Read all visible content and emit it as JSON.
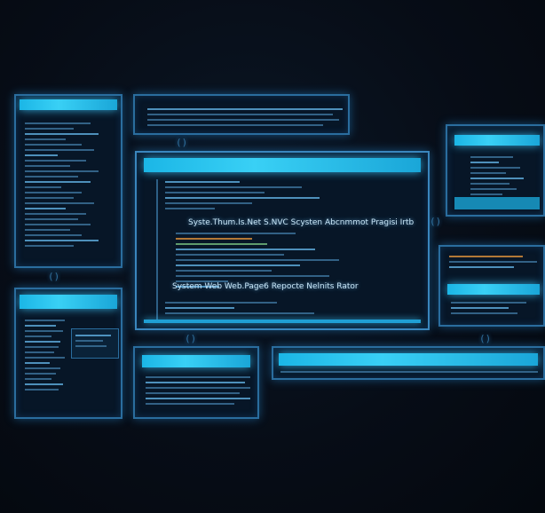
{
  "main_editor": {
    "line1": "Syste.Thum.Is.Net S.NVC Scysten Abcnmmot Pragisi Irtb",
    "line2": "System Web Web.Page6 Repocte Nelnits Rator"
  },
  "connectors": {
    "top": "()",
    "right": "()",
    "left_mid": "()",
    "bottom_left": "()",
    "bottom_right": "()"
  },
  "colors": {
    "accent": "#39d0f5",
    "border": "#2a6d9e",
    "background": "#070d17"
  }
}
